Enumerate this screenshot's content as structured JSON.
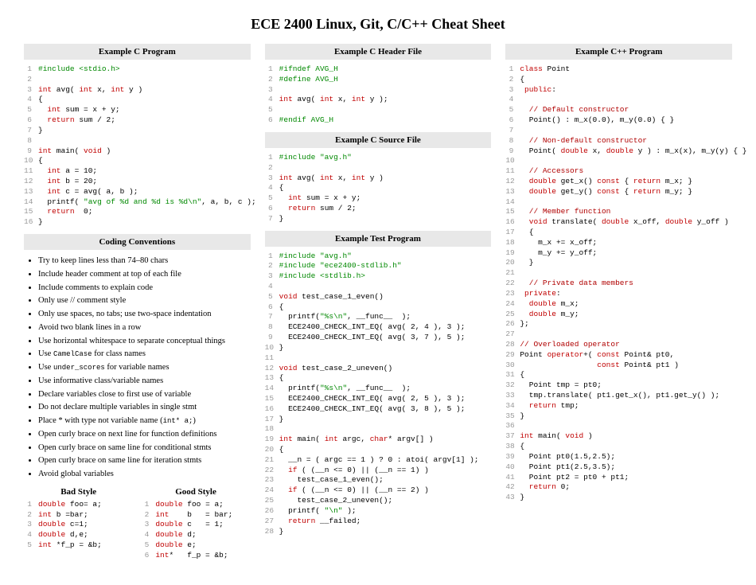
{
  "title": "ECE 2400 Linux, Git, C/C++ Cheat Sheet",
  "sections": {
    "c_program": "Example C Program",
    "conventions": "Coding Conventions",
    "bad_style": "Bad Style",
    "good_style": "Good Style",
    "c_header": "Example C Header File",
    "c_source": "Example C Source File",
    "test_program": "Example Test Program",
    "cpp_program": "Example C++ Program"
  },
  "code": {
    "c_program": [
      [
        {
          "t": "#include <stdio.h>",
          "c": "pp"
        }
      ],
      [],
      [
        {
          "t": "int",
          "c": "kw"
        },
        {
          "t": " avg( "
        },
        {
          "t": "int",
          "c": "kw"
        },
        {
          "t": " x, "
        },
        {
          "t": "int",
          "c": "kw"
        },
        {
          "t": " y )"
        }
      ],
      [
        {
          "t": "{"
        }
      ],
      [
        {
          "t": "  "
        },
        {
          "t": "int",
          "c": "kw"
        },
        {
          "t": " sum = x + y;"
        }
      ],
      [
        {
          "t": "  "
        },
        {
          "t": "return",
          "c": "kw"
        },
        {
          "t": " sum / 2;"
        }
      ],
      [
        {
          "t": "}"
        }
      ],
      [],
      [
        {
          "t": "int",
          "c": "kw"
        },
        {
          "t": " main( "
        },
        {
          "t": "void",
          "c": "kw"
        },
        {
          "t": " )"
        }
      ],
      [
        {
          "t": "{"
        }
      ],
      [
        {
          "t": "  "
        },
        {
          "t": "int",
          "c": "kw"
        },
        {
          "t": " a = 10;"
        }
      ],
      [
        {
          "t": "  "
        },
        {
          "t": "int",
          "c": "kw"
        },
        {
          "t": " b = 20;"
        }
      ],
      [
        {
          "t": "  "
        },
        {
          "t": "int",
          "c": "kw"
        },
        {
          "t": " c = avg( a, b );"
        }
      ],
      [
        {
          "t": "  printf( "
        },
        {
          "t": "\"avg of %d and %d is %d\\n\"",
          "c": "str"
        },
        {
          "t": ", a, b, c );"
        }
      ],
      [
        {
          "t": "  "
        },
        {
          "t": "return",
          "c": "kw"
        },
        {
          "t": "  0;"
        }
      ],
      [
        {
          "t": "}"
        }
      ]
    ],
    "c_header": [
      [
        {
          "t": "#ifndef AVG_H",
          "c": "pp"
        }
      ],
      [
        {
          "t": "#define AVG_H",
          "c": "pp"
        }
      ],
      [],
      [
        {
          "t": "int",
          "c": "kw"
        },
        {
          "t": " avg( "
        },
        {
          "t": "int",
          "c": "kw"
        },
        {
          "t": " x, "
        },
        {
          "t": "int",
          "c": "kw"
        },
        {
          "t": " y );"
        }
      ],
      [],
      [
        {
          "t": "#endif AVG_H",
          "c": "pp"
        }
      ]
    ],
    "c_source": [
      [
        {
          "t": "#include \"avg.h\"",
          "c": "pp"
        }
      ],
      [],
      [
        {
          "t": "int",
          "c": "kw"
        },
        {
          "t": " avg( "
        },
        {
          "t": "int",
          "c": "kw"
        },
        {
          "t": " x, "
        },
        {
          "t": "int",
          "c": "kw"
        },
        {
          "t": " y )"
        }
      ],
      [
        {
          "t": "{"
        }
      ],
      [
        {
          "t": "  "
        },
        {
          "t": "int",
          "c": "kw"
        },
        {
          "t": " sum = x + y;"
        }
      ],
      [
        {
          "t": "  "
        },
        {
          "t": "return",
          "c": "kw"
        },
        {
          "t": " sum / 2;"
        }
      ],
      [
        {
          "t": "}"
        }
      ]
    ],
    "test_program": [
      [
        {
          "t": "#include \"avg.h\"",
          "c": "pp"
        }
      ],
      [
        {
          "t": "#include \"ece2400-stdlib.h\"",
          "c": "pp"
        }
      ],
      [
        {
          "t": "#include <stdlib.h>",
          "c": "pp"
        }
      ],
      [],
      [
        {
          "t": "void",
          "c": "kw"
        },
        {
          "t": " test_case_1_even()"
        }
      ],
      [
        {
          "t": "{"
        }
      ],
      [
        {
          "t": "  printf("
        },
        {
          "t": "\"%s\\n\"",
          "c": "str"
        },
        {
          "t": ", __func__  );"
        }
      ],
      [
        {
          "t": "  ECE2400_CHECK_INT_EQ( avg( 2, 4 ), 3 );"
        }
      ],
      [
        {
          "t": "  ECE2400_CHECK_INT_EQ( avg( 3, 7 ), 5 );"
        }
      ],
      [
        {
          "t": "}"
        }
      ],
      [],
      [
        {
          "t": "void",
          "c": "kw"
        },
        {
          "t": " test_case_2_uneven()"
        }
      ],
      [
        {
          "t": "{"
        }
      ],
      [
        {
          "t": "  printf("
        },
        {
          "t": "\"%s\\n\"",
          "c": "str"
        },
        {
          "t": ", __func__  );"
        }
      ],
      [
        {
          "t": "  ECE2400_CHECK_INT_EQ( avg( 2, 5 ), 3 );"
        }
      ],
      [
        {
          "t": "  ECE2400_CHECK_INT_EQ( avg( 3, 8 ), 5 );"
        }
      ],
      [
        {
          "t": "}"
        }
      ],
      [],
      [
        {
          "t": "int",
          "c": "kw"
        },
        {
          "t": " main( "
        },
        {
          "t": "int",
          "c": "kw"
        },
        {
          "t": " argc, "
        },
        {
          "t": "char",
          "c": "kw"
        },
        {
          "t": "* argv[] )"
        }
      ],
      [
        {
          "t": "{"
        }
      ],
      [
        {
          "t": "  __n = ( argc == 1 ) ? 0 : atoi( argv[1] );"
        }
      ],
      [
        {
          "t": "  "
        },
        {
          "t": "if",
          "c": "kw"
        },
        {
          "t": " ( (__n <= 0) || (__n == 1) )"
        }
      ],
      [
        {
          "t": "    test_case_1_even();"
        }
      ],
      [
        {
          "t": "  "
        },
        {
          "t": "if",
          "c": "kw"
        },
        {
          "t": " ( (__n <= 0) || (__n == 2) )"
        }
      ],
      [
        {
          "t": "    test_case_2_uneven();"
        }
      ],
      [
        {
          "t": "  printf( "
        },
        {
          "t": "\"\\n\"",
          "c": "str"
        },
        {
          "t": " );"
        }
      ],
      [
        {
          "t": "  "
        },
        {
          "t": "return",
          "c": "kw"
        },
        {
          "t": " __failed;"
        }
      ],
      [
        {
          "t": "}"
        }
      ]
    ],
    "cpp_program": [
      [
        {
          "t": "class",
          "c": "kw"
        },
        {
          "t": " Point"
        }
      ],
      [
        {
          "t": "{"
        }
      ],
      [
        {
          "t": " "
        },
        {
          "t": "public",
          "c": "kw"
        },
        {
          "t": ":"
        }
      ],
      [],
      [
        {
          "t": "  "
        },
        {
          "t": "// Default constructor",
          "c": "cm"
        }
      ],
      [
        {
          "t": "  Point() : m_x(0.0), m_y(0.0) { }"
        }
      ],
      [],
      [
        {
          "t": "  "
        },
        {
          "t": "// Non-default constructor",
          "c": "cm"
        }
      ],
      [
        {
          "t": "  Point( "
        },
        {
          "t": "double",
          "c": "kw"
        },
        {
          "t": " x, "
        },
        {
          "t": "double",
          "c": "kw"
        },
        {
          "t": " y ) : m_x(x), m_y(y) { }"
        }
      ],
      [],
      [
        {
          "t": "  "
        },
        {
          "t": "// Accessors",
          "c": "cm"
        }
      ],
      [
        {
          "t": "  "
        },
        {
          "t": "double",
          "c": "kw"
        },
        {
          "t": " get_x() "
        },
        {
          "t": "const",
          "c": "kw"
        },
        {
          "t": " { "
        },
        {
          "t": "return",
          "c": "kw"
        },
        {
          "t": " m_x; }"
        }
      ],
      [
        {
          "t": "  "
        },
        {
          "t": "double",
          "c": "kw"
        },
        {
          "t": " get_y() "
        },
        {
          "t": "const",
          "c": "kw"
        },
        {
          "t": " { "
        },
        {
          "t": "return",
          "c": "kw"
        },
        {
          "t": " m_y; }"
        }
      ],
      [],
      [
        {
          "t": "  "
        },
        {
          "t": "// Member function",
          "c": "cm"
        }
      ],
      [
        {
          "t": "  "
        },
        {
          "t": "void",
          "c": "kw"
        },
        {
          "t": " translate( "
        },
        {
          "t": "double",
          "c": "kw"
        },
        {
          "t": " x_off, "
        },
        {
          "t": "double",
          "c": "kw"
        },
        {
          "t": " y_off )"
        }
      ],
      [
        {
          "t": "  {"
        }
      ],
      [
        {
          "t": "    m_x += x_off;"
        }
      ],
      [
        {
          "t": "    m_y += y_off;"
        }
      ],
      [
        {
          "t": "  }"
        }
      ],
      [],
      [
        {
          "t": "  "
        },
        {
          "t": "// Private data members",
          "c": "cm"
        }
      ],
      [
        {
          "t": " "
        },
        {
          "t": "private",
          "c": "kw"
        },
        {
          "t": ":"
        }
      ],
      [
        {
          "t": "  "
        },
        {
          "t": "double",
          "c": "kw"
        },
        {
          "t": " m_x;"
        }
      ],
      [
        {
          "t": "  "
        },
        {
          "t": "double",
          "c": "kw"
        },
        {
          "t": " m_y;"
        }
      ],
      [
        {
          "t": "};"
        }
      ],
      [],
      [
        {
          "t": "// Overloaded operator",
          "c": "cm"
        }
      ],
      [
        {
          "t": "Point "
        },
        {
          "t": "operator",
          "c": "kw"
        },
        {
          "t": "+( "
        },
        {
          "t": "const",
          "c": "kw"
        },
        {
          "t": " Point& pt0,"
        }
      ],
      [
        {
          "t": "                 "
        },
        {
          "t": "const",
          "c": "kw"
        },
        {
          "t": " Point& pt1 )"
        }
      ],
      [
        {
          "t": "{"
        }
      ],
      [
        {
          "t": "  Point tmp = pt0;"
        }
      ],
      [
        {
          "t": "  tmp.translate( pt1.get_x(), pt1.get_y() );"
        }
      ],
      [
        {
          "t": "  "
        },
        {
          "t": "return",
          "c": "kw"
        },
        {
          "t": " tmp;"
        }
      ],
      [
        {
          "t": "}"
        }
      ],
      [],
      [
        {
          "t": "int",
          "c": "kw"
        },
        {
          "t": " main( "
        },
        {
          "t": "void",
          "c": "kw"
        },
        {
          "t": " )"
        }
      ],
      [
        {
          "t": "{"
        }
      ],
      [
        {
          "t": "  Point pt0(1.5,2.5);"
        }
      ],
      [
        {
          "t": "  Point pt1(2.5,3.5);"
        }
      ],
      [
        {
          "t": "  Point pt2 = pt0 + pt1;"
        }
      ],
      [
        {
          "t": "  "
        },
        {
          "t": "return",
          "c": "kw"
        },
        {
          "t": " 0;"
        }
      ],
      [
        {
          "t": "}"
        }
      ]
    ],
    "bad_style": [
      [
        {
          "t": "double",
          "c": "kw"
        },
        {
          "t": " foo= a;"
        }
      ],
      [
        {
          "t": "int",
          "c": "kw"
        },
        {
          "t": " b =bar;"
        }
      ],
      [
        {
          "t": "double",
          "c": "kw"
        },
        {
          "t": " c=1;"
        }
      ],
      [
        {
          "t": "double",
          "c": "kw"
        },
        {
          "t": " d,e;"
        }
      ],
      [
        {
          "t": "int",
          "c": "kw"
        },
        {
          "t": " *f_p = &b;"
        }
      ]
    ],
    "good_style": [
      [
        {
          "t": "double",
          "c": "kw"
        },
        {
          "t": " foo = a;"
        }
      ],
      [
        {
          "t": "int",
          "c": "kw"
        },
        {
          "t": "    b   = bar;"
        }
      ],
      [
        {
          "t": "double",
          "c": "kw"
        },
        {
          "t": " c   = 1;"
        }
      ],
      [
        {
          "t": "double",
          "c": "kw"
        },
        {
          "t": " d;"
        }
      ],
      [
        {
          "t": "double",
          "c": "kw"
        },
        {
          "t": " e;"
        }
      ],
      [
        {
          "t": "int",
          "c": "kw"
        },
        {
          "t": "*   f_p = &b;"
        }
      ]
    ]
  },
  "conventions": [
    "Try to keep lines less than 74–80 chars",
    "Include header comment at top of each file",
    "Include comments to explain code",
    "Only use // comment style",
    "Only use spaces, no tabs; use two-space indentation",
    "Avoid two blank lines in a row",
    "Use horizontal whitespace to separate conceptual things",
    "Use |CamelCase| for class names",
    "Use |under_scores| for variable names",
    "Use informative class/variable names",
    "Declare variables close to first use of variable",
    "Do not declare multiple variables in single stmt",
    "Place * with type not variable name (|int* a;|)",
    "Open curly brace on next line for function definitions",
    "Open curly brace on same line for conditional stmts",
    "Open curly brace on same line for iteration stmts",
    "Avoid global variables"
  ]
}
